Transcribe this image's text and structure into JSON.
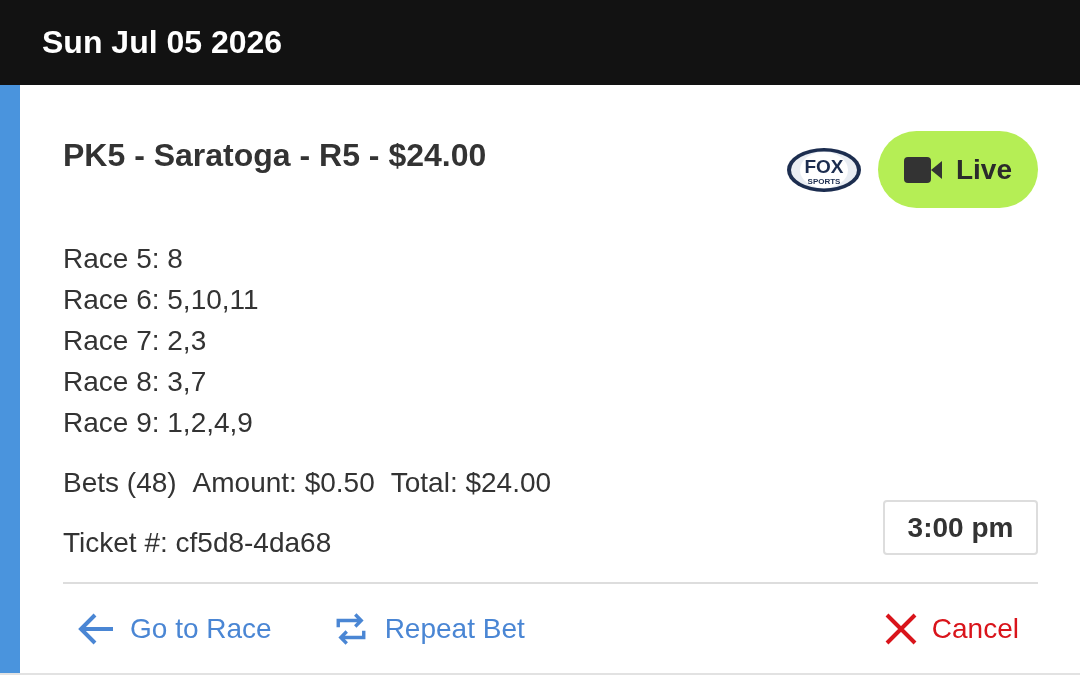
{
  "header": {
    "date": "Sun Jul 05 2026"
  },
  "bet": {
    "title": "PK5 - Saratoga - R5 - $24.00",
    "broadcaster_logo": {
      "line_1": "FOX",
      "line_2": "SPORTS"
    },
    "live_button": {
      "label": "Live"
    },
    "legs": [
      "Race 5: 8",
      "Race 6: 5,10,11",
      "Race 7: 2,3",
      "Race 8: 3,7",
      "Race 9: 1,2,4,9"
    ],
    "summary": [
      "Bets (48)",
      "Amount: $0.50",
      "Total: $24.00"
    ],
    "ticket": "Ticket #: cf5d8-4da68",
    "time": "3:00 pm",
    "actions": [
      {
        "kind": "go_to_race",
        "label": "Go to Race"
      },
      {
        "kind": "repeat",
        "label": "Repeat Bet"
      },
      {
        "kind": "cancel",
        "label": "Cancel"
      }
    ]
  }
}
